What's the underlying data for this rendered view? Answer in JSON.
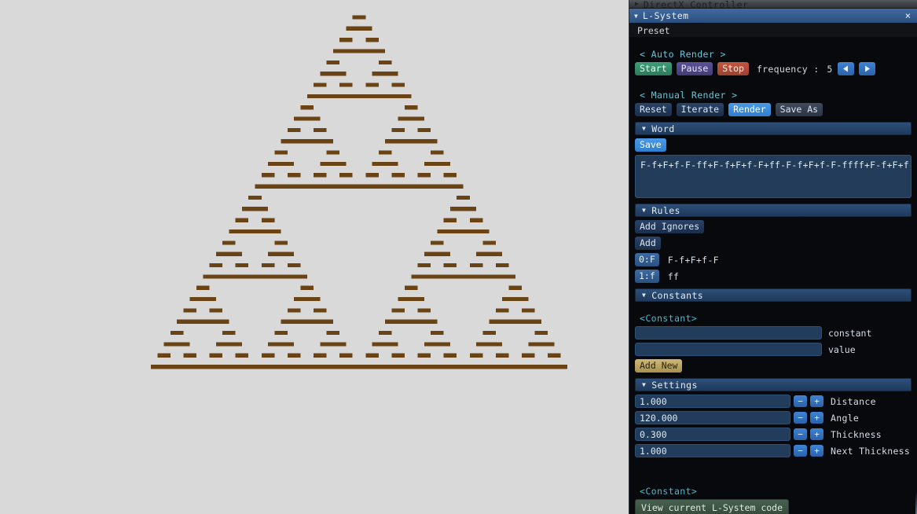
{
  "windows": {
    "collapsed": {
      "title": "DirectX Controller",
      "triangle": "▶"
    },
    "active": {
      "title": "L-System",
      "triangle": "▼",
      "close": "×"
    }
  },
  "preset": {
    "label": "Preset"
  },
  "auto_render": {
    "header": "< Auto Render >",
    "start": "Start",
    "pause": "Pause",
    "stop": "Stop",
    "frequency_label": "frequency :",
    "frequency_value": "5",
    "prev_arrow": "◀",
    "next_arrow": "▶"
  },
  "manual_render": {
    "header": "< Manual Render >",
    "reset": "Reset",
    "iterate": "Iterate",
    "render": "Render",
    "save_as": "Save As"
  },
  "word": {
    "section": "Word",
    "triangle": "▼",
    "save": "Save",
    "value": "F-f+F+f-F-ff+F-f+F+f-F+ff-F-f+F+f-F-ffff+F-f+F+f-F-f"
  },
  "rules": {
    "section": "Rules",
    "triangle": "▼",
    "add_ignores": "Add Ignores",
    "add": "Add",
    "items": [
      {
        "key": "0:F",
        "value": "F-f+F+f-F"
      },
      {
        "key": "1:f",
        "value": "ff"
      }
    ]
  },
  "constants": {
    "section": "Constants",
    "triangle": "▼",
    "group_label": "<Constant>",
    "constant_value": "",
    "constant_caption": "constant",
    "value_value": "",
    "value_caption": "value",
    "add_new": "Add New"
  },
  "settings": {
    "section": "Settings",
    "triangle": "▼",
    "minus": "−",
    "plus": "+",
    "rows": [
      {
        "value": "1.000",
        "caption": "Distance"
      },
      {
        "value": "120.000",
        "caption": "Angle"
      },
      {
        "value": "0.300",
        "caption": "Thickness"
      },
      {
        "value": "1.000",
        "caption": "Next Thickness"
      }
    ]
  },
  "footer": {
    "group_label": "<Constant>",
    "view_code": "View current L-System code"
  },
  "canvas": {
    "background_color": "#d9d9d9",
    "line_color": "#6b4415",
    "description": "Sierpinski arrowhead / triangle L-System render"
  },
  "colors": {
    "accent_blue": "#2f7fd0",
    "panel_bg": "#08090c",
    "section_bar": "#2d4f79",
    "cyan_label": "#63c7d8",
    "gold": "#cdb878",
    "green": "#3f9d78",
    "red": "#c4563f",
    "purple": "#5b5198"
  }
}
